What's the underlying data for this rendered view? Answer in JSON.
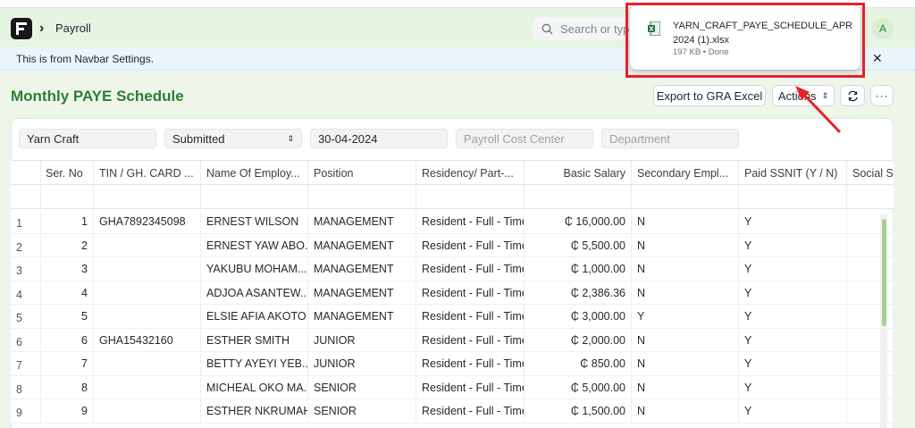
{
  "navbar": {
    "breadcrumb": "Payroll",
    "search_placeholder": "Search or type",
    "avatar_initial": "A"
  },
  "banner": {
    "text": "This is from Navbar Settings."
  },
  "page": {
    "title": "Monthly PAYE Schedule",
    "export_label": "Export to GRA Excel",
    "actions_label": "Actions"
  },
  "filters": {
    "company": "Yarn Craft",
    "status": "Submitted",
    "date": "30-04-2024",
    "cost_center_placeholder": "Payroll Cost Center",
    "department_placeholder": "Department"
  },
  "table": {
    "columns": [
      "Ser. No",
      "TIN / GH. CARD ...",
      "Name Of Employ...",
      "Position",
      "Residency/ Part-...",
      "Basic Salary",
      "Secondary Empl...",
      "Paid SSNIT (Y / N)",
      "Social S"
    ],
    "rows": [
      {
        "idx": "1",
        "ser": "1",
        "tin": "GHA7892345098",
        "name": "ERNEST WILSON",
        "position": "MANAGEMENT",
        "residency": "Resident - Full - Time",
        "salary": "₵ 16,000.00",
        "secondary": "N",
        "ssnit": "Y"
      },
      {
        "idx": "2",
        "ser": "2",
        "tin": "",
        "name": "ERNEST YAW ABO...",
        "position": "MANAGEMENT",
        "residency": "Resident - Full - Time",
        "salary": "₵ 5,500.00",
        "secondary": "N",
        "ssnit": "Y"
      },
      {
        "idx": "3",
        "ser": "3",
        "tin": "",
        "name": "YAKUBU MOHAM...",
        "position": "MANAGEMENT",
        "residency": "Resident - Full - Time",
        "salary": "₵ 1,000.00",
        "secondary": "N",
        "ssnit": "Y"
      },
      {
        "idx": "4",
        "ser": "4",
        "tin": "",
        "name": "ADJOA ASANTEW...",
        "position": "MANAGEMENT",
        "residency": "Resident - Full - Time",
        "salary": "₵ 2,386.36",
        "secondary": "N",
        "ssnit": "Y"
      },
      {
        "idx": "5",
        "ser": "5",
        "tin": "",
        "name": "ELSIE AFIA AKOTO",
        "position": "MANAGEMENT",
        "residency": "Resident - Full - Time",
        "salary": "₵ 3,000.00",
        "secondary": "Y",
        "ssnit": "Y"
      },
      {
        "idx": "6",
        "ser": "6",
        "tin": "GHA15432160",
        "name": "ESTHER SMITH",
        "position": "JUNIOR",
        "residency": "Resident - Full - Time",
        "salary": "₵ 2,000.00",
        "secondary": "N",
        "ssnit": "Y"
      },
      {
        "idx": "7",
        "ser": "7",
        "tin": "",
        "name": "BETTY AYEYI YEB...",
        "position": "JUNIOR",
        "residency": "Resident - Full - Time",
        "salary": "₵ 850.00",
        "secondary": "N",
        "ssnit": "Y"
      },
      {
        "idx": "8",
        "ser": "8",
        "tin": "",
        "name": "MICHEAL OKO MA...",
        "position": "SENIOR",
        "residency": "Resident - Full - Time",
        "salary": "₵ 5,000.00",
        "secondary": "N",
        "ssnit": "Y"
      },
      {
        "idx": "9",
        "ser": "9",
        "tin": "",
        "name": "ESTHER NKRUMAH",
        "position": "SENIOR",
        "residency": "Resident - Full - Time",
        "salary": "₵ 1,500.00",
        "secondary": "N",
        "ssnit": "Y"
      }
    ]
  },
  "download": {
    "filename": "YARN_CRAFT_PAYE_SCHEDULE_APR 2024 (1).xlsx",
    "meta": "197 KB • Done"
  },
  "colors": {
    "title_green": "#2e7d32",
    "highlight_red": "#e8202a",
    "excel_green": "#1d6f42"
  }
}
